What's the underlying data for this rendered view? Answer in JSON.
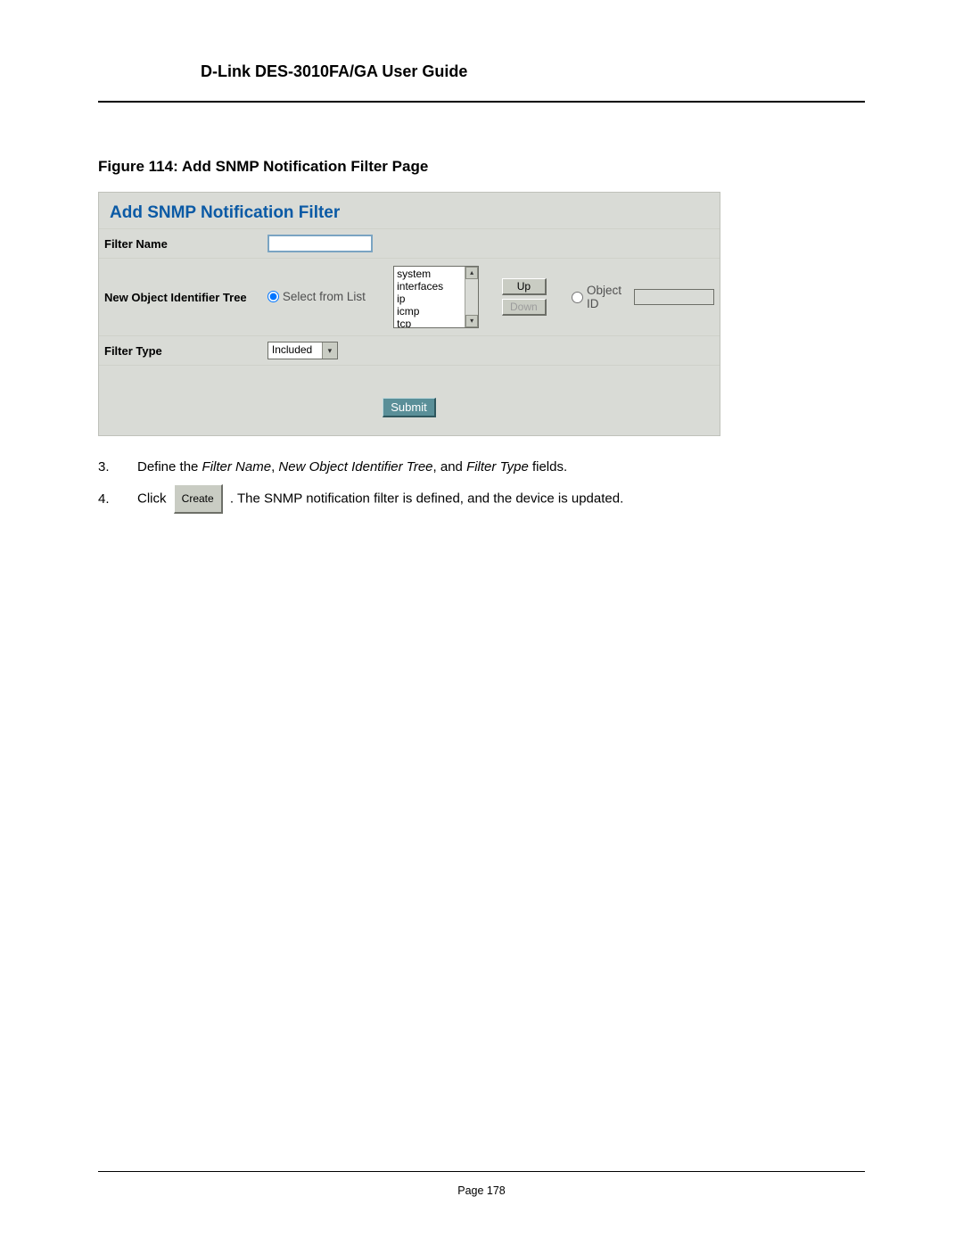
{
  "doc": {
    "header_title": "D-Link DES-3010FA/GA User Guide",
    "figure_caption": "Figure 114: Add SNMP Notification Filter Page",
    "footer": "Page 178"
  },
  "panel": {
    "title": "Add SNMP Notification Filter",
    "labels": {
      "filter_name": "Filter Name",
      "new_oid_tree": "New Object Identifier Tree",
      "filter_type": "Filter Type"
    },
    "radios": {
      "select_from_list": "Select from List",
      "object_id": "Object ID"
    },
    "list_options": [
      "system",
      "interfaces",
      "ip",
      "icmp",
      "tcp"
    ],
    "buttons": {
      "up": "Up",
      "down": "Down",
      "submit": "Submit"
    },
    "filter_type_value": "Included"
  },
  "instructions": {
    "step3_num": "3.",
    "step3_lead": "Define the ",
    "step3_f1": "Filter Name",
    "step3_sep1": ", ",
    "step3_f2": "New Object Identifier Tree",
    "step3_sep2": ", and ",
    "step3_f3": "Filter Type",
    "step3_tail": " fields.",
    "step4_num": "4.",
    "step4_lead": "Click ",
    "create_label": "Create",
    "step4_tail": ". The SNMP notification filter is defined, and the device is updated."
  }
}
